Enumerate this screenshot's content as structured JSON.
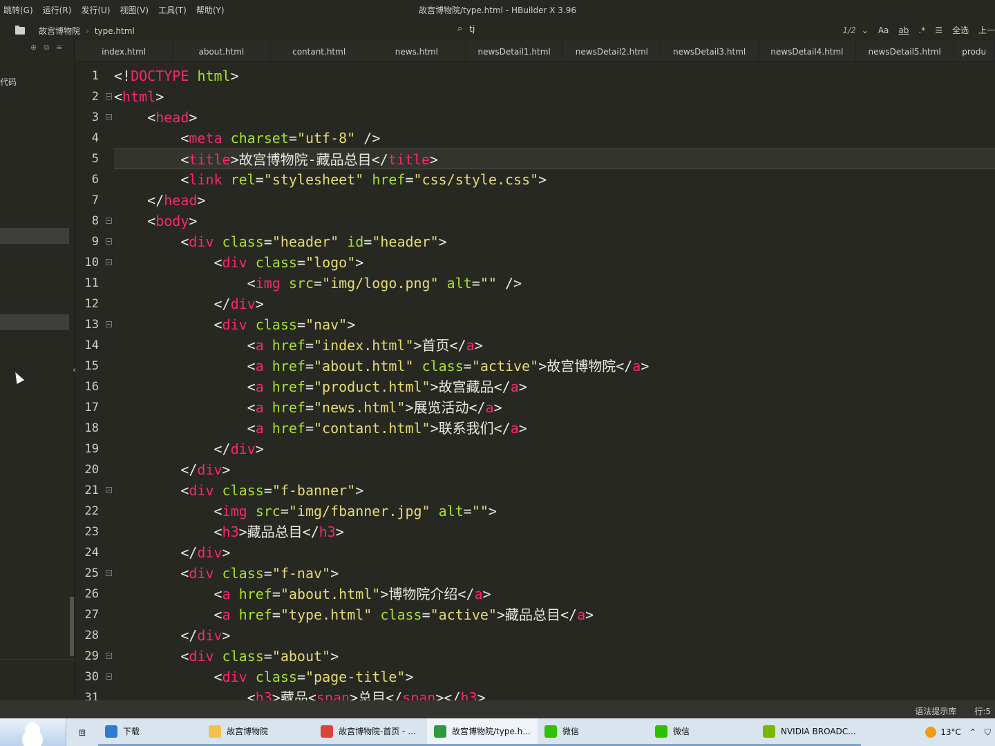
{
  "menubar": {
    "items": [
      "跳转(G)",
      "运行(R)",
      "发行(U)",
      "视图(V)",
      "工具(T)",
      "帮助(Y)"
    ],
    "window_title": "故宫博物院/type.html - HBuilder X 3.96"
  },
  "breadcrumb": {
    "project": "故宫博物院",
    "file": "type.html"
  },
  "find": {
    "value": "tj",
    "count": "1/2",
    "match_case": "Aa",
    "whole_word": "ab",
    "regex": ".*",
    "select_all": "全选",
    "prev": "上一"
  },
  "sidepanel": {
    "label": "代码"
  },
  "tabs": [
    "index.html",
    "about.html",
    "contant.html",
    "news.html",
    "newsDetail1.html",
    "newsDetail2.html",
    "newsDetail3.html",
    "newsDetail4.html",
    "newsDetail5.html",
    "produ"
  ],
  "editor": {
    "current_line": 5,
    "folded_lines": [
      2,
      3,
      8,
      9,
      10,
      13,
      21,
      25,
      29,
      30
    ],
    "lines": [
      [
        [
          "p",
          "<!"
        ],
        [
          "t",
          "DOCTYPE"
        ],
        [
          "p",
          " "
        ],
        [
          "a",
          "html"
        ],
        [
          "p",
          ">"
        ]
      ],
      [
        [
          "p",
          "<"
        ],
        [
          "t",
          "html"
        ],
        [
          "p",
          ">"
        ]
      ],
      [
        [
          "p",
          "    <"
        ],
        [
          "t",
          "head"
        ],
        [
          "p",
          ">"
        ]
      ],
      [
        [
          "p",
          "        <"
        ],
        [
          "t",
          "meta"
        ],
        [
          "p",
          " "
        ],
        [
          "a",
          "charset"
        ],
        [
          "p",
          "="
        ],
        [
          "s",
          "\"utf-8\""
        ],
        [
          "p",
          " />"
        ]
      ],
      [
        [
          "p",
          "        <"
        ],
        [
          "t",
          "title"
        ],
        [
          "p",
          ">故宫博物院-藏品总目</"
        ],
        [
          "t",
          "title"
        ],
        [
          "p",
          ">"
        ]
      ],
      [
        [
          "p",
          "        <"
        ],
        [
          "t",
          "link"
        ],
        [
          "p",
          " "
        ],
        [
          "a",
          "rel"
        ],
        [
          "p",
          "="
        ],
        [
          "s",
          "\"stylesheet\""
        ],
        [
          "p",
          " "
        ],
        [
          "a",
          "href"
        ],
        [
          "p",
          "="
        ],
        [
          "s",
          "\"css/style.css\""
        ],
        [
          "p",
          ">"
        ]
      ],
      [
        [
          "p",
          "    </"
        ],
        [
          "t",
          "head"
        ],
        [
          "p",
          ">"
        ]
      ],
      [
        [
          "p",
          "    <"
        ],
        [
          "t",
          "body"
        ],
        [
          "p",
          ">"
        ]
      ],
      [
        [
          "p",
          "        <"
        ],
        [
          "t",
          "div"
        ],
        [
          "p",
          " "
        ],
        [
          "a",
          "class"
        ],
        [
          "p",
          "="
        ],
        [
          "s",
          "\"header\""
        ],
        [
          "p",
          " "
        ],
        [
          "a",
          "id"
        ],
        [
          "p",
          "="
        ],
        [
          "s",
          "\"header\""
        ],
        [
          "p",
          ">"
        ]
      ],
      [
        [
          "p",
          "            <"
        ],
        [
          "t",
          "div"
        ],
        [
          "p",
          " "
        ],
        [
          "a",
          "class"
        ],
        [
          "p",
          "="
        ],
        [
          "s",
          "\"logo\""
        ],
        [
          "p",
          ">"
        ]
      ],
      [
        [
          "p",
          "                <"
        ],
        [
          "t",
          "img"
        ],
        [
          "p",
          " "
        ],
        [
          "a",
          "src"
        ],
        [
          "p",
          "="
        ],
        [
          "s",
          "\"img/logo.png\""
        ],
        [
          "p",
          " "
        ],
        [
          "a",
          "alt"
        ],
        [
          "p",
          "="
        ],
        [
          "s",
          "\"\""
        ],
        [
          "p",
          " />"
        ]
      ],
      [
        [
          "p",
          "            </"
        ],
        [
          "t",
          "div"
        ],
        [
          "p",
          ">"
        ]
      ],
      [
        [
          "p",
          "            <"
        ],
        [
          "t",
          "div"
        ],
        [
          "p",
          " "
        ],
        [
          "a",
          "class"
        ],
        [
          "p",
          "="
        ],
        [
          "s",
          "\"nav\""
        ],
        [
          "p",
          ">"
        ]
      ],
      [
        [
          "p",
          "                <"
        ],
        [
          "t",
          "a"
        ],
        [
          "p",
          " "
        ],
        [
          "a",
          "href"
        ],
        [
          "p",
          "="
        ],
        [
          "s",
          "\"index.html\""
        ],
        [
          "p",
          ">首页</"
        ],
        [
          "t",
          "a"
        ],
        [
          "p",
          ">"
        ]
      ],
      [
        [
          "p",
          "                <"
        ],
        [
          "t",
          "a"
        ],
        [
          "p",
          " "
        ],
        [
          "a",
          "href"
        ],
        [
          "p",
          "="
        ],
        [
          "s",
          "\"about.html\""
        ],
        [
          "p",
          " "
        ],
        [
          "a",
          "class"
        ],
        [
          "p",
          "="
        ],
        [
          "s",
          "\"active\""
        ],
        [
          "p",
          ">故宫博物院</"
        ],
        [
          "t",
          "a"
        ],
        [
          "p",
          ">"
        ]
      ],
      [
        [
          "p",
          "                <"
        ],
        [
          "t",
          "a"
        ],
        [
          "p",
          " "
        ],
        [
          "a",
          "href"
        ],
        [
          "p",
          "="
        ],
        [
          "s",
          "\"product.html\""
        ],
        [
          "p",
          ">故宫藏品</"
        ],
        [
          "t",
          "a"
        ],
        [
          "p",
          ">"
        ]
      ],
      [
        [
          "p",
          "                <"
        ],
        [
          "t",
          "a"
        ],
        [
          "p",
          " "
        ],
        [
          "a",
          "href"
        ],
        [
          "p",
          "="
        ],
        [
          "s",
          "\"news.html\""
        ],
        [
          "p",
          ">展览活动</"
        ],
        [
          "t",
          "a"
        ],
        [
          "p",
          ">"
        ]
      ],
      [
        [
          "p",
          "                <"
        ],
        [
          "t",
          "a"
        ],
        [
          "p",
          " "
        ],
        [
          "a",
          "href"
        ],
        [
          "p",
          "="
        ],
        [
          "s",
          "\"contant.html\""
        ],
        [
          "p",
          ">联系我们</"
        ],
        [
          "t",
          "a"
        ],
        [
          "p",
          ">"
        ]
      ],
      [
        [
          "p",
          "            </"
        ],
        [
          "t",
          "div"
        ],
        [
          "p",
          ">"
        ]
      ],
      [
        [
          "p",
          "        </"
        ],
        [
          "t",
          "div"
        ],
        [
          "p",
          ">"
        ]
      ],
      [
        [
          "p",
          "        <"
        ],
        [
          "t",
          "div"
        ],
        [
          "p",
          " "
        ],
        [
          "a",
          "class"
        ],
        [
          "p",
          "="
        ],
        [
          "s",
          "\"f-banner\""
        ],
        [
          "p",
          ">"
        ]
      ],
      [
        [
          "p",
          "            <"
        ],
        [
          "t",
          "img"
        ],
        [
          "p",
          " "
        ],
        [
          "a",
          "src"
        ],
        [
          "p",
          "="
        ],
        [
          "s",
          "\"img/fbanner.jpg\""
        ],
        [
          "p",
          " "
        ],
        [
          "a",
          "alt"
        ],
        [
          "p",
          "="
        ],
        [
          "s",
          "\"\""
        ],
        [
          "p",
          ">"
        ]
      ],
      [
        [
          "p",
          "            <"
        ],
        [
          "t",
          "h3"
        ],
        [
          "p",
          ">藏品总目</"
        ],
        [
          "t",
          "h3"
        ],
        [
          "p",
          ">"
        ]
      ],
      [
        [
          "p",
          "        </"
        ],
        [
          "t",
          "div"
        ],
        [
          "p",
          ">"
        ]
      ],
      [
        [
          "p",
          "        <"
        ],
        [
          "t",
          "div"
        ],
        [
          "p",
          " "
        ],
        [
          "a",
          "class"
        ],
        [
          "p",
          "="
        ],
        [
          "s",
          "\"f-nav\""
        ],
        [
          "p",
          ">"
        ]
      ],
      [
        [
          "p",
          "            <"
        ],
        [
          "t",
          "a"
        ],
        [
          "p",
          " "
        ],
        [
          "a",
          "href"
        ],
        [
          "p",
          "="
        ],
        [
          "s",
          "\"about.html\""
        ],
        [
          "p",
          ">博物院介绍</"
        ],
        [
          "t",
          "a"
        ],
        [
          "p",
          ">"
        ]
      ],
      [
        [
          "p",
          "            <"
        ],
        [
          "t",
          "a"
        ],
        [
          "p",
          " "
        ],
        [
          "a",
          "href"
        ],
        [
          "p",
          "="
        ],
        [
          "s",
          "\"type.html\""
        ],
        [
          "p",
          " "
        ],
        [
          "a",
          "class"
        ],
        [
          "p",
          "="
        ],
        [
          "s",
          "\"active\""
        ],
        [
          "p",
          ">藏品总目</"
        ],
        [
          "t",
          "a"
        ],
        [
          "p",
          ">"
        ]
      ],
      [
        [
          "p",
          "        </"
        ],
        [
          "t",
          "div"
        ],
        [
          "p",
          ">"
        ]
      ],
      [
        [
          "p",
          "        <"
        ],
        [
          "t",
          "div"
        ],
        [
          "p",
          " "
        ],
        [
          "a",
          "class"
        ],
        [
          "p",
          "="
        ],
        [
          "s",
          "\"about\""
        ],
        [
          "p",
          ">"
        ]
      ],
      [
        [
          "p",
          "            <"
        ],
        [
          "t",
          "div"
        ],
        [
          "p",
          " "
        ],
        [
          "a",
          "class"
        ],
        [
          "p",
          "="
        ],
        [
          "s",
          "\"page-title\""
        ],
        [
          "p",
          ">"
        ]
      ],
      [
        [
          "p",
          "                <"
        ],
        [
          "t",
          "h3"
        ],
        [
          "p",
          ">藏品<"
        ],
        [
          "t",
          "span"
        ],
        [
          "p",
          ">总目</"
        ],
        [
          "t",
          "span"
        ],
        [
          "p",
          "></"
        ],
        [
          "t",
          "h3"
        ],
        [
          "p",
          ">"
        ]
      ]
    ]
  },
  "statusbar": {
    "syntax_lib": "语法提示库",
    "position": "行:5"
  },
  "taskbar": {
    "items": [
      {
        "label": "下载",
        "icon": "download-icon",
        "color": "#2e7bd6"
      },
      {
        "label": "故宫博物院",
        "icon": "folder-icon",
        "color": "#f2c14e"
      },
      {
        "label": "故宫博物院-首页 - ...",
        "icon": "chrome-icon",
        "color": "#db4437"
      },
      {
        "label": "故宫博物院/type.h...",
        "icon": "hbuilder-icon",
        "color": "#2e9a3e"
      },
      {
        "label": "微信",
        "icon": "wechat-icon",
        "color": "#2dc100"
      },
      {
        "label": "微信",
        "icon": "wechat-icon",
        "color": "#2dc100"
      },
      {
        "label": "NVIDIA BROADC...",
        "icon": "nvidia-icon",
        "color": "#76b900"
      }
    ],
    "weather": "13°C"
  }
}
